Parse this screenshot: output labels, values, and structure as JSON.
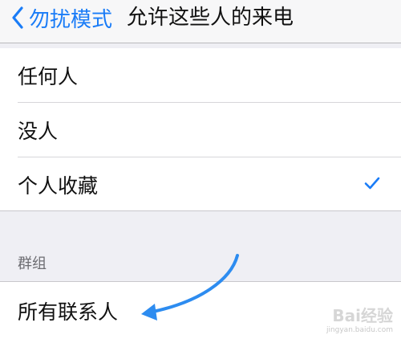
{
  "nav": {
    "back_label": "勿扰模式",
    "title": "允许这些人的来电"
  },
  "options": [
    {
      "label": "任何人",
      "selected": false
    },
    {
      "label": "没人",
      "selected": false
    },
    {
      "label": "个人收藏",
      "selected": true
    }
  ],
  "groups_section": {
    "header": "群组",
    "items": [
      {
        "label": "所有联系人"
      }
    ]
  },
  "colors": {
    "accent": "#1a7cf7",
    "background": "#efeff4",
    "annotation_arrow": "#2d8cf0"
  },
  "watermark": {
    "text": "Bai经验",
    "url": "jingyan.baidu.com"
  }
}
